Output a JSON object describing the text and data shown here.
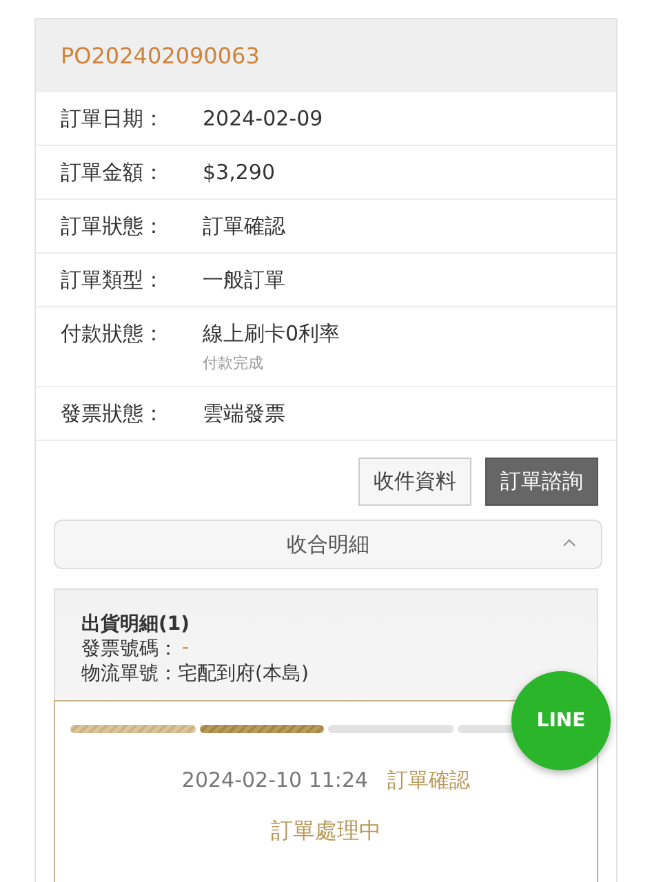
{
  "order_number": "PO202402090063",
  "fields": [
    {
      "label": "訂單日期：",
      "value": "2024-02-09"
    },
    {
      "label": "訂單金額：",
      "value": "$3,290"
    },
    {
      "label": "訂單狀態：",
      "value": "訂單確認"
    },
    {
      "label": "訂單類型：",
      "value": "一般訂單"
    },
    {
      "label": "付款狀態：",
      "value": "線上刷卡0利率",
      "note": "付款完成"
    },
    {
      "label": "發票狀態：",
      "value": "雲端發票"
    }
  ],
  "buttons": [
    {
      "label": "收件資料",
      "kind": "outline"
    },
    {
      "label": "訂單諮詢",
      "kind": "dark"
    }
  ],
  "collapse": {
    "label": "收合明細",
    "expanded": true
  },
  "shipment": {
    "title": "出貨明細(1)",
    "invoice_label": "發票號碼：",
    "invoice_value": "-",
    "logistics_label": "物流單號：",
    "logistics_value": "宅配到府(本島)",
    "progress": [
      {
        "kind": "done"
      },
      {
        "kind": "current"
      },
      {
        "kind": "pending"
      },
      {
        "kind": "pending"
      }
    ],
    "time": "2024-02-10 11:24",
    "status": "訂單確認",
    "processing": "訂單處理中"
  },
  "line_button": {
    "label": "LINE"
  }
}
